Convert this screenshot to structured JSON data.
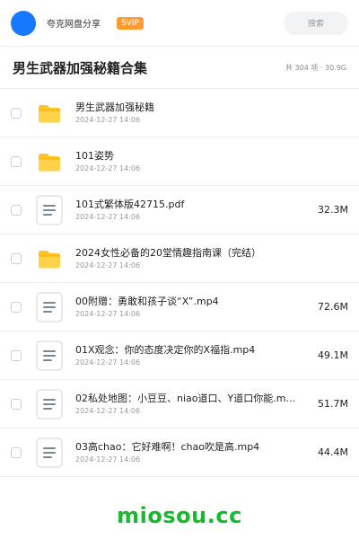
{
  "header": {
    "site_name": "夸克网盘分享",
    "badge": "SVIP",
    "search_label": "搜索"
  },
  "title_bar": {
    "title": "男生武器加强秘籍合集",
    "summary": "共 304 项 · 30.9G"
  },
  "items": [
    {
      "type": "folder",
      "name": "男生武器加强秘籍",
      "date": "2024-12-27 14:06",
      "size": ""
    },
    {
      "type": "folder",
      "name": "101姿势",
      "date": "2024-12-27 14:06",
      "size": ""
    },
    {
      "type": "file",
      "name": "101式繁体版42715.pdf",
      "date": "2024-12-27 14:06",
      "size": "32.3M"
    },
    {
      "type": "folder",
      "name": "2024女性必备的20堂情趣指南课（完结）",
      "date": "2024-12-27 14:06",
      "size": ""
    },
    {
      "type": "file",
      "name": "00附赠：勇敢和孩子谈“X”.mp4",
      "date": "2024-12-27 14:06",
      "size": "72.6M"
    },
    {
      "type": "file",
      "name": "01X观念：你的态度决定你的X福指.mp4",
      "date": "2024-12-27 14:06",
      "size": "49.1M"
    },
    {
      "type": "file",
      "name": "02私处地图：小豆豆、niao道口、Y道口你能.m…",
      "date": "2024-12-27 14:06",
      "size": "51.7M"
    },
    {
      "type": "file",
      "name": "03高chao：它好难啊！chao吹是高.mp4",
      "date": "2024-12-27 14:06",
      "size": "44.4M"
    }
  ],
  "footer": {
    "brand": "miosou.cc"
  },
  "colors": {
    "accent": "#1677ff",
    "svip": "#ff9b2f",
    "folder": "#ffc224",
    "brand": "#19b92f"
  },
  "icons": {
    "folder": "folder-icon",
    "file": "document-icon"
  }
}
